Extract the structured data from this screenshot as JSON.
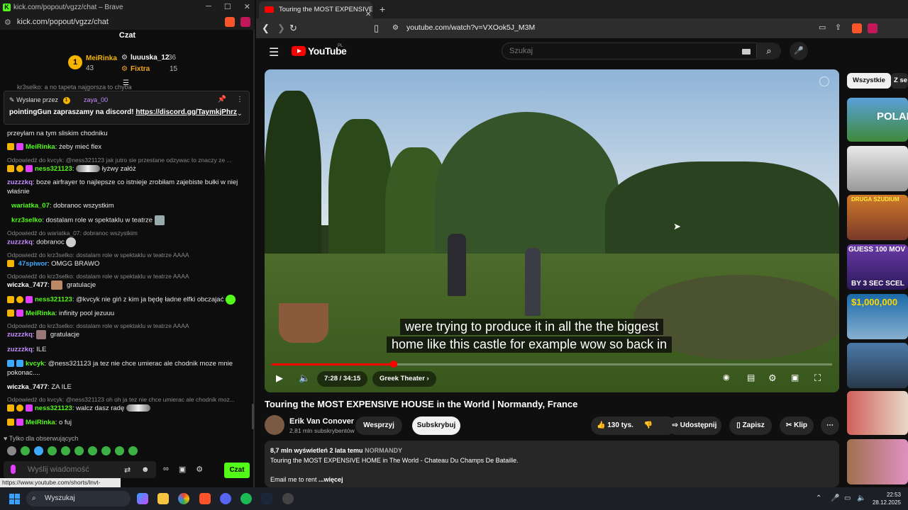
{
  "kick": {
    "window_title": "kick.com/popout/vgzz/chat – Brave",
    "url": "kick.com/popout/vgzz/chat",
    "chat_title": "Czat",
    "leaderboard": {
      "first": {
        "rank": "1",
        "name": "MeiRinka",
        "count": "43"
      },
      "second": {
        "name": "luuuska_12",
        "count": "36"
      },
      "third": {
        "name": "Fixtra",
        "count": "15"
      }
    },
    "partial_top": "kr3selko: a no tapeta najgorsza to chyba",
    "pinned": {
      "sent_by": "Wysłane przez",
      "badge": "1",
      "user": "zaya_00",
      "text": "pointingGun zapraszamy na discord!",
      "link": "https://discord.gg/TaymkjPhrz"
    },
    "messages": [
      {
        "type": "text",
        "text": "przeylam na tym sliskim chodniku"
      },
      {
        "type": "msg",
        "user": "MeiRinka",
        "color": "#53fc18",
        "text": "żeby mieć flex"
      },
      {
        "type": "reply",
        "text": "Odpowiedź do kvcyk: @ness321123 jak jutro sie przestane odzywac to znaczy ze ..."
      },
      {
        "type": "msg",
        "user": "ness321123",
        "color": "#53fc18",
        "text": "łyżwy załóż"
      },
      {
        "type": "msg",
        "user": "zuzzzkq",
        "color": "#c58cff",
        "text": "boze airfrayer to najlepsze co istnieje zrobiłam zajebiste bułki w niej właśnie"
      },
      {
        "type": "msg",
        "user": "wariatka_07",
        "color": "#53fc18",
        "text": "dobranoc wszystkim"
      },
      {
        "type": "msg",
        "user": "krz3selko",
        "color": "#53fc18",
        "text": "dostalam role w spektaklu w teatrze"
      },
      {
        "type": "reply",
        "text": "Odpowiedź do wariatka_07: dobranoc wszystkim"
      },
      {
        "type": "msg",
        "user": "zuzzzkq",
        "color": "#c58cff",
        "text": "dobranoc"
      },
      {
        "type": "reply",
        "text": "Odpowiedź do krz3selko: dostalam role w spektaklu w teatrze AAAA"
      },
      {
        "type": "msg",
        "user": "47spiwor",
        "color": "#3da9fc",
        "text": "OMGG BRAWO"
      },
      {
        "type": "reply",
        "text": "Odpowiedź do krz3selko: dostalam role w spektaklu w teatrze AAAA"
      },
      {
        "type": "msg",
        "user": "wiczka_7477",
        "color": "#ffffff",
        "text": "gratulacje"
      },
      {
        "type": "msg",
        "user": "ness321123",
        "color": "#53fc18",
        "text": "@kvcyk nie giń z kim ja będę ładne elfki obczajać"
      },
      {
        "type": "msg",
        "user": "MeiRinka",
        "color": "#53fc18",
        "text": "infinity pool jezuuu"
      },
      {
        "type": "reply",
        "text": "Odpowiedź do krz3selko: dostalam role w spektaklu w teatrze AAAA"
      },
      {
        "type": "msg",
        "user": "zuzzzkq",
        "color": "#c58cff",
        "text": "gratulacje"
      },
      {
        "type": "msg",
        "user": "zuzzzkq",
        "color": "#c58cff",
        "text": "ILE"
      },
      {
        "type": "msg",
        "user": "kvcyk",
        "color": "#53fc18",
        "text": "@ness321123 ja tez nie chce umierac ale chodnik moze mnie pokonac...."
      },
      {
        "type": "msg",
        "user": "wiczka_7477",
        "color": "#ffffff",
        "text": "ZA ILE"
      },
      {
        "type": "reply",
        "text": "Odpowiedź do kvcyk: @ness321123 oh oh ja tez nie chce umierac ale chodnik moz..."
      },
      {
        "type": "msg",
        "user": "ness321123",
        "color": "#53fc18",
        "text": "walcz dasz radę"
      },
      {
        "type": "msg",
        "user": "MeiRinka",
        "color": "#53fc18",
        "text": "o fuj"
      }
    ],
    "followers_only": "Tylko dla obserwujących",
    "input_placeholder": "Wyślij wiadomość",
    "send_label": "Czat",
    "status_url": "https://www.youtube.com/shorts/lnvt-v34o5M"
  },
  "brave": {
    "tab_title": "Touring the MOST EXPENSIVE HOUSE in the World",
    "url": "youtube.com/watch?v=VXOok5J_M3M",
    "yt_word": "YouTube",
    "yt_region": "PL",
    "search_placeholder": "Szukaj",
    "video": {
      "subtitle_1": "were trying to produce it in all the the biggest",
      "subtitle_2": "home like this castle for example wow so back in",
      "time": "7:28 / 34:15",
      "chapter": "Greek Theater",
      "progress": 0.218,
      "title": "Touring the MOST EXPENSIVE HOUSE in the World | Normandy, France"
    },
    "channel": {
      "name": "Erik Van Conover",
      "subs": "2,81 mln subskrybentów"
    },
    "buttons": {
      "join": "Wesprzyj",
      "subscribe": "Subskrybuj",
      "likes": "130 tys.",
      "share": "Udostępnij",
      "save": "Zapisz",
      "clip": "Klip"
    },
    "description": {
      "meta": "8,7 mln wyświetleń  2 lata temu",
      "tag": "NORMANDY",
      "line1": "Touring the MOST EXPENSIVE HOME in The World - Chateau Du Champs De Bataille.",
      "line2": "Email me to rent",
      "more": "...więcej"
    },
    "chips": [
      "Wszystkie",
      "Z se"
    ],
    "thumbs": [
      "POLAND",
      "DRUGA SZUDIUM",
      "GUESS 100 MOV",
      "BY 3 SEC SCEL",
      "$1,000,000"
    ]
  },
  "taskbar": {
    "search": "Wyszukaj",
    "time": "22:53",
    "date": "28.12.2025"
  }
}
